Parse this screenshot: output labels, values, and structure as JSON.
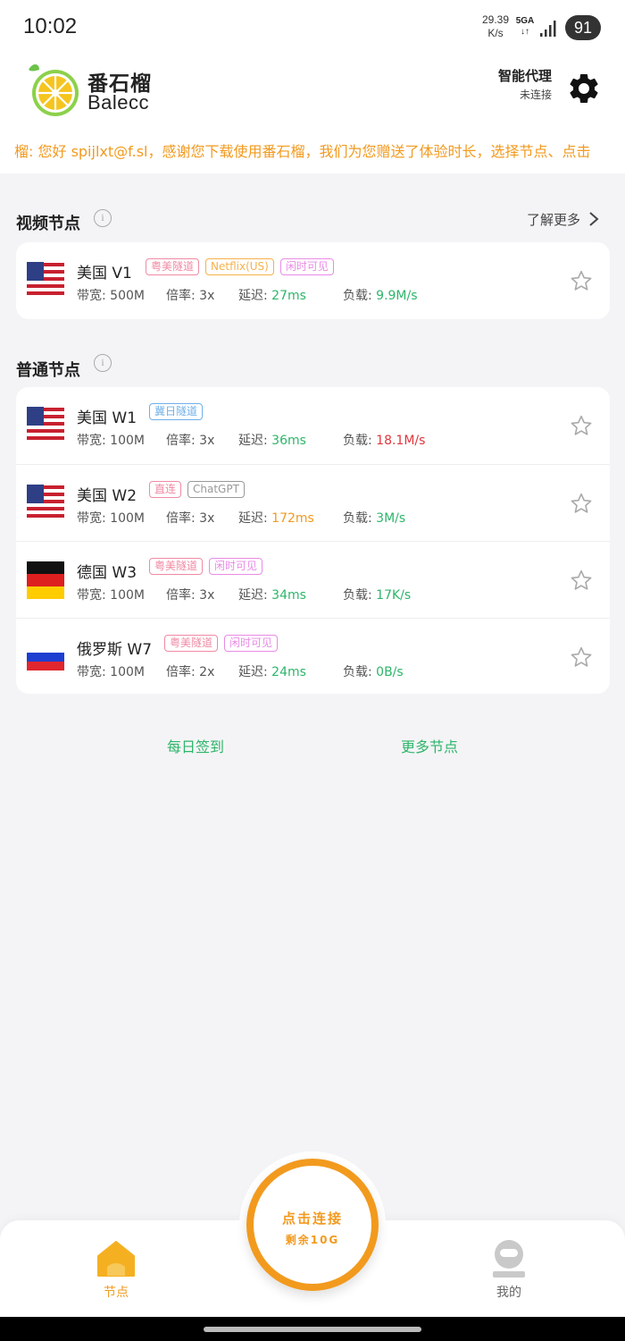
{
  "status_bar": {
    "time": "10:02",
    "speed_value": "29.39",
    "speed_unit": "K/s",
    "network": "5GA",
    "network_arrows": "↓↑",
    "battery": "91"
  },
  "header": {
    "brand_cn": "番石榴",
    "brand_en": "Balecc",
    "proxy_title": "智能代理",
    "proxy_status": "未连接",
    "announcement": "榴: 您好 spijlxt@f.sl，感谢您下载使用番石榴，我们为您赠送了体验时长，选择节点、点击"
  },
  "video_section": {
    "title": "视频节点",
    "learn_more": "了解更多",
    "nodes": [
      {
        "name": "美国 V1",
        "flag": "us-flag",
        "tags": [
          {
            "text": "粤美隧道",
            "color": "#f08aa3"
          },
          {
            "text": "Netflix(US)",
            "color": "#f5b14a"
          },
          {
            "text": "闲时可见",
            "color": "#e98be6"
          }
        ],
        "bandwidth_label": "带宽:",
        "bandwidth": "500M",
        "rate_label": "倍率:",
        "rate": "3x",
        "latency_label": "延迟:",
        "latency": "27ms",
        "latency_color": "#2db56a",
        "load_label": "负载:",
        "load": "9.9M/s",
        "load_color": "#2db56a"
      }
    ]
  },
  "normal_section": {
    "title": "普通节点",
    "nodes": [
      {
        "name": "美国 W1",
        "flag": "us-flag",
        "tags": [
          {
            "text": "冀日隧道",
            "color": "#6fb0e8"
          }
        ],
        "bandwidth_label": "带宽:",
        "bandwidth": "100M",
        "rate_label": "倍率:",
        "rate": "3x",
        "latency_label": "延迟:",
        "latency": "36ms",
        "latency_color": "#2db56a",
        "load_label": "负载:",
        "load": "18.1M/s",
        "load_color": "#e0363c"
      },
      {
        "name": "美国 W2",
        "flag": "us-flag",
        "tags": [
          {
            "text": "直连",
            "color": "#f08aa3"
          },
          {
            "text": "ChatGPT",
            "color": "#999999"
          }
        ],
        "bandwidth_label": "带宽:",
        "bandwidth": "100M",
        "rate_label": "倍率:",
        "rate": "3x",
        "latency_label": "延迟:",
        "latency": "172ms",
        "latency_color": "#f29a1e",
        "load_label": "负载:",
        "load": "3M/s",
        "load_color": "#2db56a"
      },
      {
        "name": "德国 W3",
        "flag": "de-flag",
        "tags": [
          {
            "text": "粤美隧道",
            "color": "#f08aa3"
          },
          {
            "text": "闲时可见",
            "color": "#e98be6"
          }
        ],
        "bandwidth_label": "带宽:",
        "bandwidth": "100M",
        "rate_label": "倍率:",
        "rate": "3x",
        "latency_label": "延迟:",
        "latency": "34ms",
        "latency_color": "#2db56a",
        "load_label": "负载:",
        "load": "17K/s",
        "load_color": "#2db56a"
      },
      {
        "name": "俄罗斯 W7",
        "flag": "ru-flag",
        "tags": [
          {
            "text": "粤美隧道",
            "color": "#f08aa3"
          },
          {
            "text": "闲时可见",
            "color": "#e98be6"
          }
        ],
        "bandwidth_label": "带宽:",
        "bandwidth": "100M",
        "rate_label": "倍率:",
        "rate": "2x",
        "latency_label": "延迟:",
        "latency": "24ms",
        "latency_color": "#2db56a",
        "load_label": "负载:",
        "load": "0B/s",
        "load_color": "#2db56a"
      }
    ]
  },
  "actions": {
    "daily_checkin": "每日签到",
    "more_nodes": "更多节点"
  },
  "connect": {
    "label": "点击连接",
    "remaining": "剩余10G"
  },
  "bottom_nav": {
    "home_label": "节点",
    "me_label": "我的"
  },
  "colors": {
    "accent": "#f29a1e",
    "green": "#2db56a",
    "red": "#e0363c"
  }
}
